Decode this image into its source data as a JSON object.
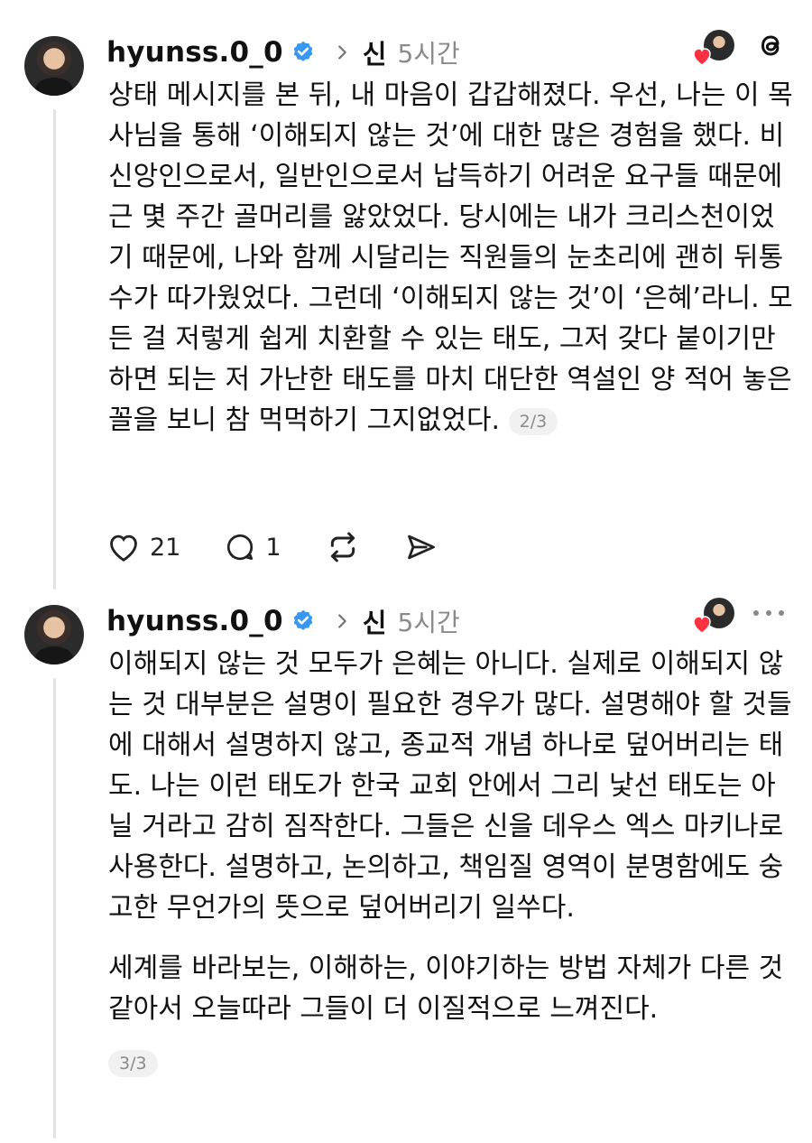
{
  "posts": [
    {
      "username": "hyunss.0_0",
      "reply_to": "신",
      "time": "5시간",
      "paragraphs": [
        "상태 메시지를 본 뒤, 내 마음이 갑갑해졌다. 우선, 나는 이 목사님을 통해 ‘이해되지 않는 것’에 대한 많은 경험을 했다. 비신앙인으로서, 일반인으로서 납득하기 어려운 요구들 때문에 근 몇 주간 골머리를 앓았었다. 당시에는 내가 크리스천이었기 때문에, 나와 함께 시달리는 직원들의 눈초리에 괜히 뒤통수가 따가웠었다. 그런데 ‘이해되지 않는 것’이 ‘은혜’라니. 모든 걸 저렇게 쉽게 치환할 수 있는 태도, 그저 갖다 붙이기만 하면 되는 저 가난한 태도를 마치 대단한 역설인 양 적어 놓은 꼴을 보니 참 먹먹하기 그지없었다."
      ],
      "page": "2/3",
      "likes": "21",
      "replies": "1"
    },
    {
      "username": "hyunss.0_0",
      "reply_to": "신",
      "time": "5시간",
      "paragraphs": [
        "이해되지 않는 것 모두가 은혜는 아니다. 실제로 이해되지 않는 것 대부분은 설명이 필요한 경우가 많다. 설명해야 할 것들에 대해서 설명하지 않고, 종교적 개념 하나로 덮어버리는 태도. 나는 이런 태도가 한국 교회 안에서 그리 낯선 태도는 아닐 거라고 감히 짐작한다. 그들은 신을 데우스 엑스 마키나로 사용한다. 설명하고, 논의하고, 책임질 영역이 분명함에도 숭고한 무언가의 뜻으로 덮어버리기 일쑤다.",
        "세계를 바라보는, 이해하는, 이야기하는 방법 자체가 다른 것 같아서 오늘따라 그들이 더 이질적으로 느껴진다."
      ],
      "page": "3/3"
    }
  ],
  "colors": {
    "verified": "#3897f0",
    "heart": "#ff3040"
  },
  "icons": [
    "verified-badge-icon",
    "chevron-right-icon",
    "heart-icon",
    "reply-icon",
    "repost-icon",
    "share-icon",
    "threads-logo-icon",
    "more-icon"
  ]
}
